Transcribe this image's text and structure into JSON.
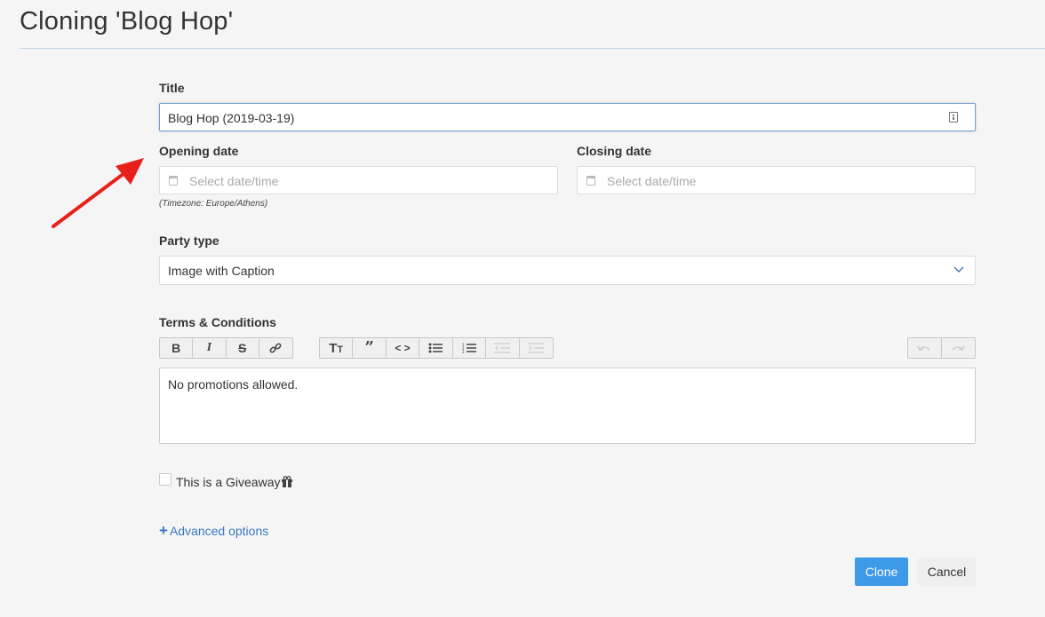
{
  "page": {
    "title": "Cloning 'Blog Hop'"
  },
  "form": {
    "title_label": "Title",
    "title_value": "Blog Hop (2019-03-19)",
    "opening_label": "Opening date",
    "opening_placeholder": "Select date/time",
    "closing_label": "Closing date",
    "closing_placeholder": "Select date/time",
    "timezone_hint": "(Timezone: Europe/Athens)",
    "party_type_label": "Party type",
    "party_type_value": "Image with Caption",
    "terms_label": "Terms & Conditions",
    "terms_text": "No promotions allowed.",
    "giveaway_label": "This is a Giveaway",
    "advanced_label": "Advanced options"
  },
  "toolbar": {
    "group1": [
      "bold-icon",
      "italic-icon",
      "strikethrough-icon",
      "link-icon"
    ],
    "group2": [
      "heading-icon",
      "quote-icon",
      "code-icon",
      "bullet-list-icon",
      "numbered-list-icon",
      "outdent-icon",
      "indent-icon"
    ],
    "group3": [
      "undo-icon",
      "redo-icon"
    ]
  },
  "actions": {
    "clone_label": "Clone",
    "cancel_label": "Cancel"
  },
  "colors": {
    "primary": "#3c9ae8",
    "link": "#3b78c2",
    "annotation_arrow": "#e8201b"
  }
}
